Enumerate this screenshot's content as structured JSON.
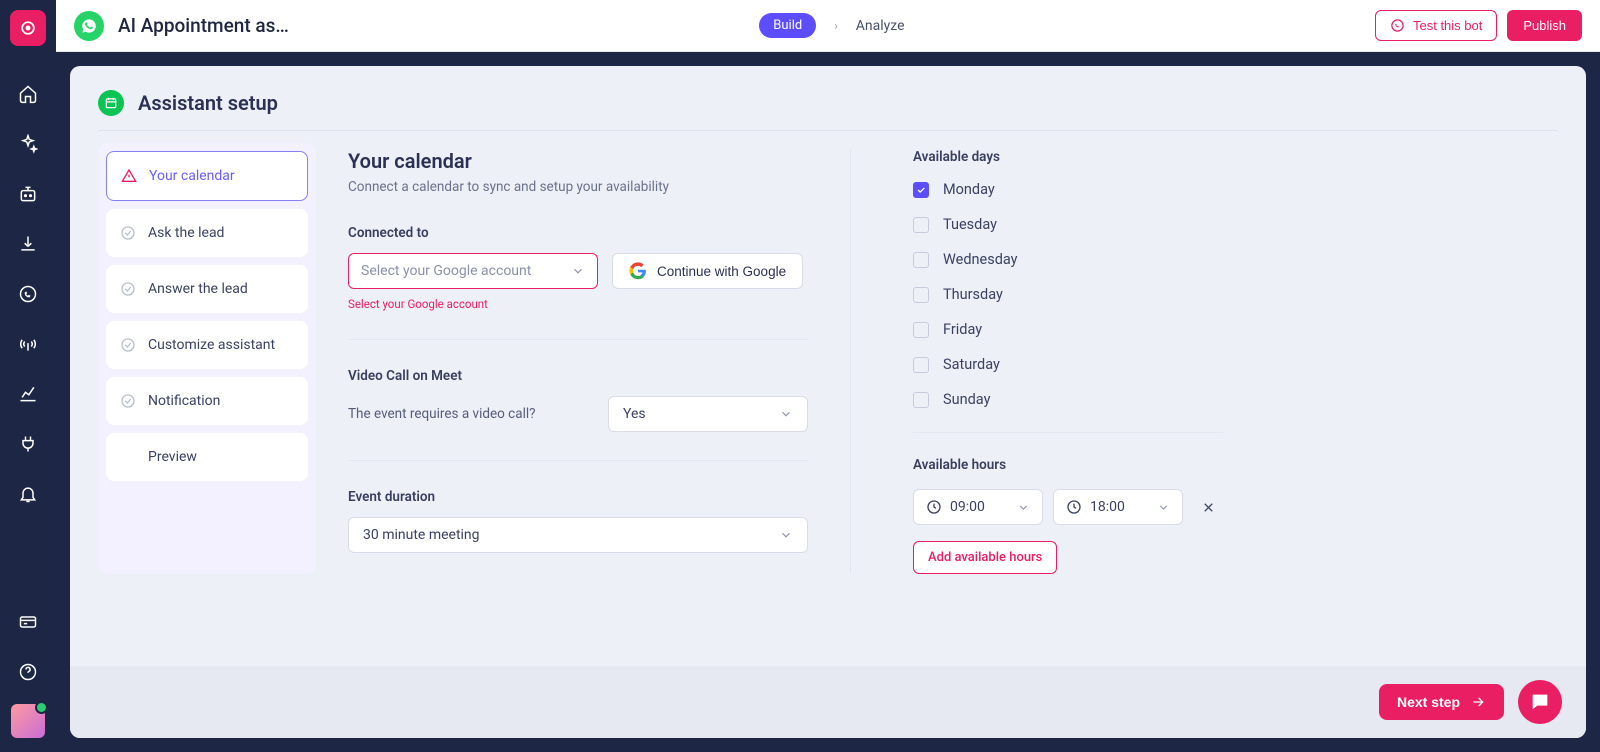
{
  "header": {
    "app_title": "AI Appointment as…",
    "build": "Build",
    "analyze": "Analyze",
    "test_bot": "Test this bot",
    "publish": "Publish"
  },
  "page": {
    "title": "Assistant setup"
  },
  "steps": [
    {
      "label": "Your calendar",
      "active": true,
      "warning": true
    },
    {
      "label": "Ask the lead"
    },
    {
      "label": "Answer the lead"
    },
    {
      "label": "Customize assistant"
    },
    {
      "label": "Notification"
    },
    {
      "label": "Preview",
      "no_icon": true
    }
  ],
  "calendar": {
    "title": "Your calendar",
    "subtitle": "Connect a calendar to sync and setup your availability",
    "connected_to_label": "Connected to",
    "account_placeholder": "Select your Google account",
    "google_btn": "Continue with Google",
    "error": "Select your Google account",
    "video_title": "Video Call on Meet",
    "video_question": "The event requires a video call?",
    "video_value": "Yes",
    "duration_label": "Event duration",
    "duration_value": "30 minute meeting"
  },
  "availability": {
    "days_label": "Available days",
    "days": [
      {
        "name": "Monday",
        "checked": true
      },
      {
        "name": "Tuesday",
        "checked": false
      },
      {
        "name": "Wednesday",
        "checked": false
      },
      {
        "name": "Thursday",
        "checked": false
      },
      {
        "name": "Friday",
        "checked": false
      },
      {
        "name": "Saturday",
        "checked": false
      },
      {
        "name": "Sunday",
        "checked": false
      }
    ],
    "hours_label": "Available hours",
    "from": "09:00",
    "to": "18:00",
    "add_hours": "Add available hours"
  },
  "footer": {
    "next": "Next step"
  }
}
